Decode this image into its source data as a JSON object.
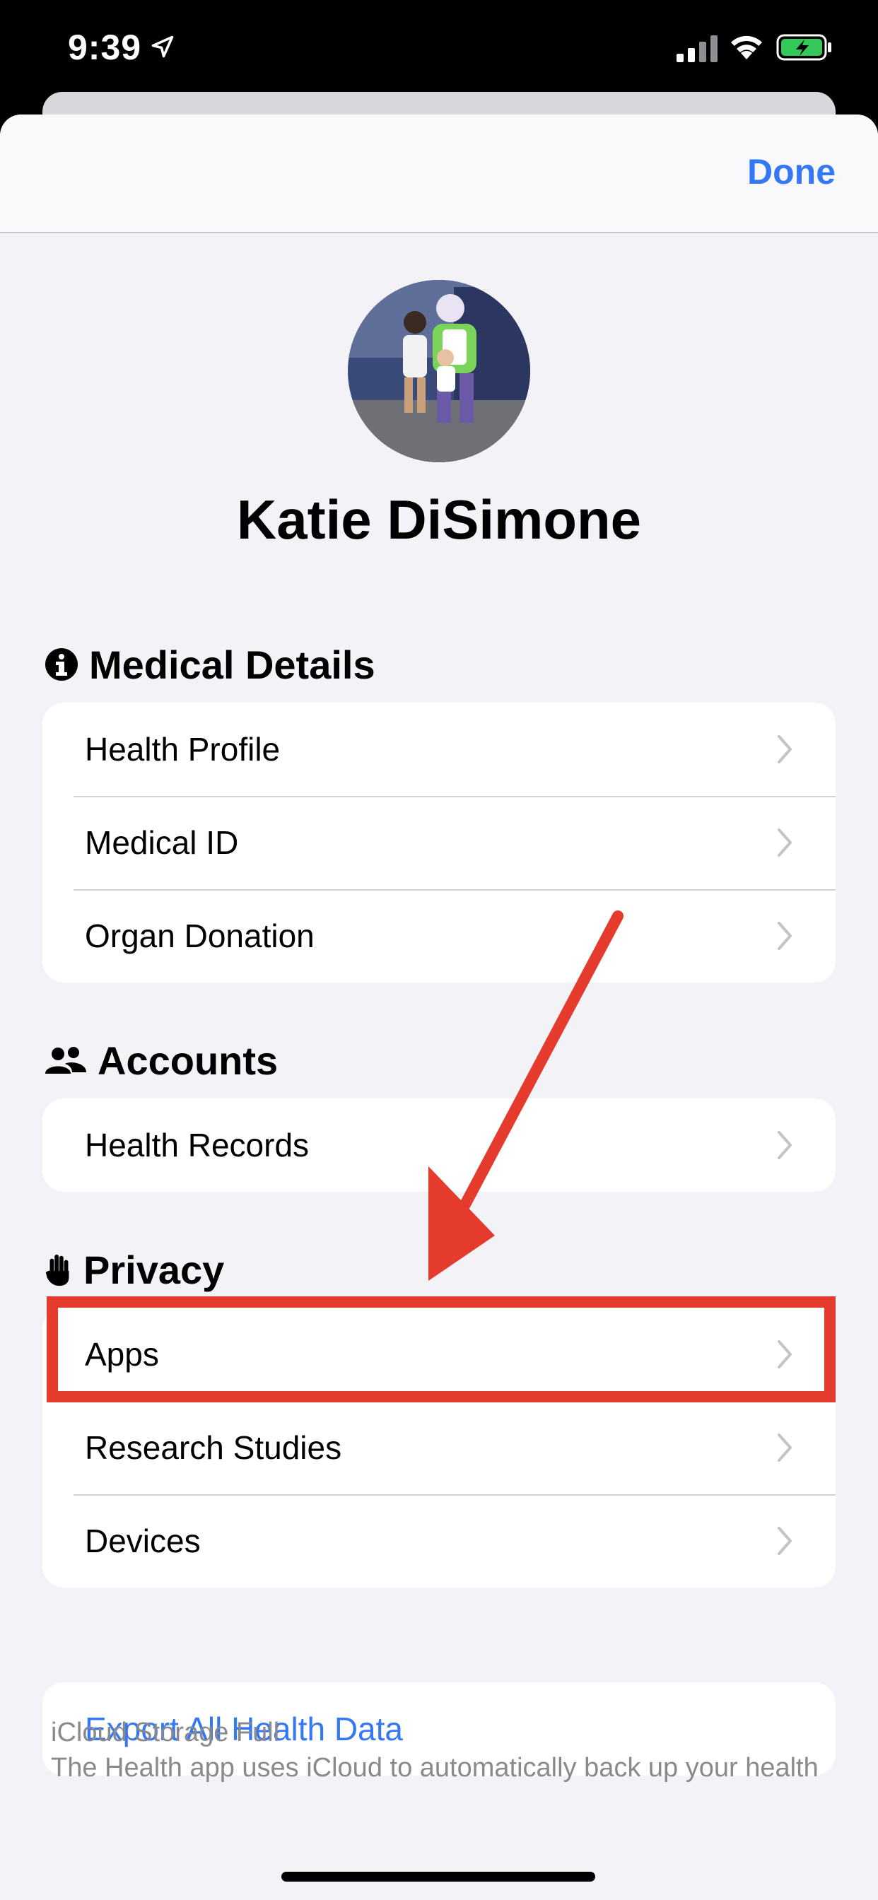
{
  "status_bar": {
    "time": "9:39"
  },
  "nav": {
    "done_label": "Done"
  },
  "profile": {
    "name": "Katie DiSimone"
  },
  "sections": {
    "medical": {
      "title": "Medical Details",
      "icon": "info-circle-icon",
      "items": [
        {
          "label": "Health Profile"
        },
        {
          "label": "Medical ID"
        },
        {
          "label": "Organ Donation"
        }
      ]
    },
    "accounts": {
      "title": "Accounts",
      "icon": "people-icon",
      "items": [
        {
          "label": "Health Records"
        }
      ]
    },
    "privacy": {
      "title": "Privacy",
      "icon": "hand-icon",
      "items": [
        {
          "label": "Apps"
        },
        {
          "label": "Research Studies"
        },
        {
          "label": "Devices"
        }
      ]
    }
  },
  "export": {
    "label": "Export All Health Data"
  },
  "footer": {
    "title": "iCloud Storage Full",
    "text": "The Health app uses iCloud to automatically back up your health"
  },
  "colors": {
    "accent": "#3478f6",
    "annotation": "#e53b2c",
    "background": "#f2f2f7"
  }
}
